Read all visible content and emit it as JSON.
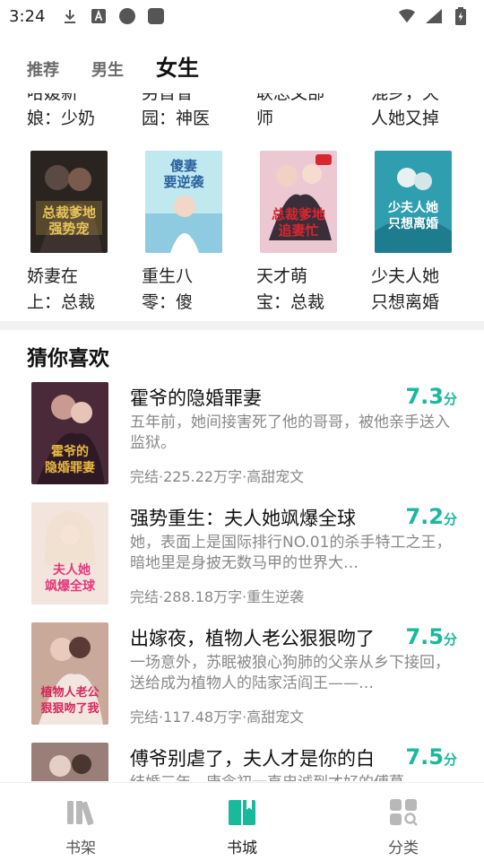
{
  "status_bar": {
    "time": "3:24"
  },
  "tabs": [
    {
      "label": "推荐"
    },
    {
      "label": "男生"
    },
    {
      "label": "女生"
    }
  ],
  "grid": {
    "clipped_row": [
      {
        "line1": "哈媛新",
        "line2": "娘：少奶"
      },
      {
        "line1": "另首省",
        "line2": "园：神医"
      },
      {
        "line1": "联总文部",
        "line2": "师"
      },
      {
        "line1": "混乡，天",
        "line2": "人她又掉"
      }
    ],
    "books": [
      {
        "line1": "娇妻在",
        "line2": "上：总裁",
        "cover_text": "总裁爹地强势宠",
        "cover_bg": "#2a2420",
        "cover_accent": "#d7b24a"
      },
      {
        "line1": "重生八",
        "line2": "零：傻",
        "cover_text": "傻妻要逆袭",
        "cover_bg": "#a8dfe9",
        "cover_accent": "#2a5f9f"
      },
      {
        "line1": "天才萌",
        "line2": "宝：总裁",
        "cover_text": "总裁爹地追妻忙",
        "cover_bg": "#e8c1cf",
        "cover_accent": "#d8262f"
      },
      {
        "line1": "少夫人她",
        "line2": "只想离婚",
        "cover_text": "少夫人她只想离婚",
        "cover_bg": "#2f9fb0",
        "cover_accent": "#ffffff"
      }
    ]
  },
  "section": {
    "title": "猜你喜欢"
  },
  "recommendations": [
    {
      "title": "霍爷的隐婚罪妻",
      "score": "7.3",
      "unit": "分",
      "desc": "五年前，她间接害死了他的哥哥，被他亲手送入监狱。",
      "meta": "完结·225.22万字·高甜宠文",
      "cover_text": "霍爷的隐婚罪妻",
      "cover_bg": "#4a2a38",
      "cover_accent": "#e6b640"
    },
    {
      "title": "强势重生：夫人她飒爆全球",
      "score": "7.2",
      "unit": "分",
      "desc": "她，表面上是国际排行NO.01的杀手特工之王，暗地里是身披无数马甲的世界大…",
      "meta": "完结·288.18万字·重生逆袭",
      "cover_text": "夫人她飒爆全球",
      "cover_bg": "#f3e4dd",
      "cover_accent": "#e23a7a"
    },
    {
      "title": "出嫁夜，植物人老公狠狠吻了",
      "score": "7.5",
      "unit": "分",
      "desc": "一场意外，苏眠被狼心狗肺的父亲从乡下接回，送给成为植物人的陆家活阎王——…",
      "meta": "完结·117.48万字·高甜宠文",
      "cover_text": "植物人老公狠狠吻了我",
      "cover_bg": "#c9a99a",
      "cover_accent": "#d8265a"
    },
    {
      "title": "傅爷别虐了，夫人才是你的白",
      "score": "7.5",
      "unit": "分",
      "desc": "结婚三年，唐念初一直忠诚到才好的傅慕",
      "meta": "",
      "cover_text": "",
      "cover_bg": "#9a7f78",
      "cover_accent": "#ffffff"
    }
  ],
  "bottom_nav": [
    {
      "label": "书架",
      "icon": "bookshelf-icon"
    },
    {
      "label": "书城",
      "icon": "bookstore-icon"
    },
    {
      "label": "分类",
      "icon": "category-icon"
    }
  ],
  "colors": {
    "accent": "#19b99c",
    "divider": "#f2f2f2"
  }
}
